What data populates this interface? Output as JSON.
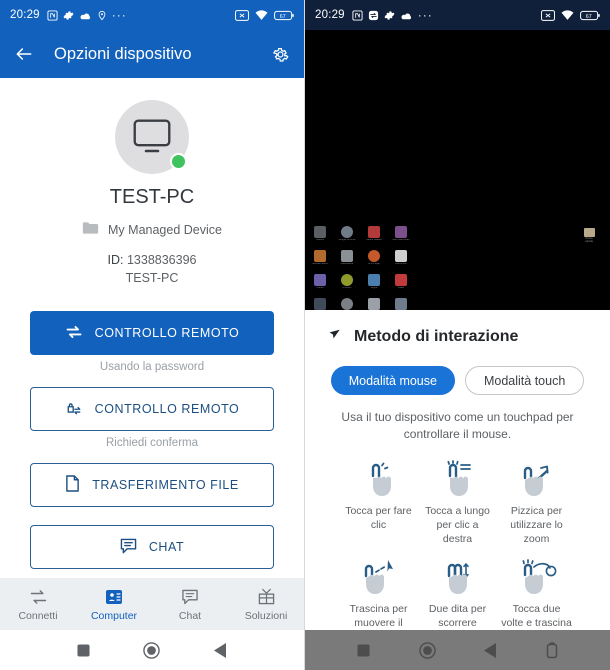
{
  "left": {
    "statusbar": {
      "time": "20:29",
      "icons": [
        "nfc-icon",
        "settings-gear-icon",
        "cloud-icon",
        "location-icon",
        "more-dots-icon"
      ],
      "right_icons": [
        "screenshot-icon",
        "wifi-icon",
        "battery-icon"
      ],
      "battery_level": "67"
    },
    "appbar": {
      "back_icon": "back-arrow-icon",
      "title": "Opzioni dispositivo",
      "settings_icon": "gear-icon"
    },
    "device": {
      "avatar_icon": "monitor-icon",
      "status": "online",
      "name": "TEST-PC",
      "group_icon": "folder-icon",
      "group": "My Managed Device",
      "id_label": "ID:",
      "id_value": "1338836396",
      "alias": "TEST-PC"
    },
    "actions": [
      {
        "label": "CONTROLLO REMOTO",
        "icon": "remote-control-icon",
        "style": "filled",
        "sub": "Usando la password"
      },
      {
        "label": "CONTROLLO REMOTO",
        "icon": "remote-control-lock-icon",
        "style": "outline",
        "sub": "Richiedi conferma"
      },
      {
        "label": "TRASFERIMENTO FILE",
        "icon": "file-icon",
        "style": "outline",
        "sub": ""
      },
      {
        "label": "CHAT",
        "icon": "chat-icon",
        "style": "outline",
        "sub": ""
      }
    ],
    "tabs": [
      {
        "label": "Connetti",
        "icon": "connect-icon",
        "active": false
      },
      {
        "label": "Computer",
        "icon": "computer-icon",
        "active": true
      },
      {
        "label": "Chat",
        "icon": "chat-icon",
        "active": false
      },
      {
        "label": "Soluzioni",
        "icon": "solutions-gift-icon",
        "active": false
      }
    ],
    "navbar": [
      "recents-square-icon",
      "home-circle-icon",
      "back-triangle-icon"
    ]
  },
  "right": {
    "statusbar": {
      "time": "20:29",
      "icons": [
        "nfc-icon",
        "remote-session-icon",
        "settings-gear-icon",
        "cloud-icon",
        "more-dots-icon"
      ],
      "right_icons": [
        "screenshot-icon",
        "wifi-icon",
        "battery-icon"
      ],
      "battery_level": "67"
    },
    "remote_screen": {
      "label": "remote-desktop-view",
      "desktop_icons": [
        {
          "name": "Cestino",
          "color": "#5a5f66"
        },
        {
          "name": "Google Chrome",
          "color": "#6f7b86"
        },
        {
          "name": "Adobe Reader",
          "color": "#b23a3a"
        },
        {
          "name": "Nero StartSmart",
          "color": "#7b4f8c"
        },
        {
          "name": "Mozilla Firefox",
          "color": "#b36a2c"
        },
        {
          "name": "Calcolatrice",
          "color": "#8b8f96"
        },
        {
          "name": "VLC Player",
          "color": "#c4592a"
        },
        {
          "name": "Documenti",
          "color": "#cfcfcf"
        },
        {
          "name": "iTunes",
          "color": "#6d5fa8"
        },
        {
          "name": "uTorrent",
          "color": "#8f9a2c"
        },
        {
          "name": "Skype",
          "color": "#4a7fae"
        },
        {
          "name": "Avast",
          "color": "#c23b3b"
        },
        {
          "name": "Steam",
          "color": "#3f4a5c"
        },
        {
          "name": "Winamp",
          "color": "#7b7f86"
        },
        {
          "name": "Notepad",
          "color": "#9aa0a6"
        },
        {
          "name": "Photo",
          "color": "#6e7b8c"
        }
      ],
      "right_item": "Nuova cartella"
    },
    "interaction": {
      "icon": "pointer-arrow-icon",
      "title": "Metodo di interazione",
      "modes": [
        {
          "label": "Modalità mouse",
          "selected": true
        },
        {
          "label": "Modalità touch",
          "selected": false
        }
      ],
      "description": "Usa il tuo dispositivo come un touchpad per controllare il mouse."
    },
    "gestures": [
      {
        "label": "Tocca per fare clic",
        "icon": "tap-click-icon"
      },
      {
        "label": "Tocca a lungo per clic a destra",
        "icon": "long-press-icon"
      },
      {
        "label": "Pizzica per utilizzare lo zoom",
        "icon": "pinch-zoom-icon"
      },
      {
        "label": "Trascina per muovere il mouse",
        "icon": "drag-move-icon"
      },
      {
        "label": "Due dita per scorrere",
        "icon": "two-finger-scroll-icon"
      },
      {
        "label": "Tocca due volte e trascina per selezionare",
        "icon": "double-tap-drag-icon"
      }
    ],
    "navbar": [
      "recents-square-icon",
      "home-circle-icon",
      "back-triangle-icon",
      "rotate-icon"
    ]
  },
  "colors": {
    "primary_blue": "#1161bd",
    "chip_blue": "#1a73d6",
    "outline_blue": "#2a6096",
    "online_green": "#3ec35f",
    "dark_status": "#11203a",
    "hand_gray": "#c5ccd4",
    "gesture_blue": "#2a5d85"
  }
}
